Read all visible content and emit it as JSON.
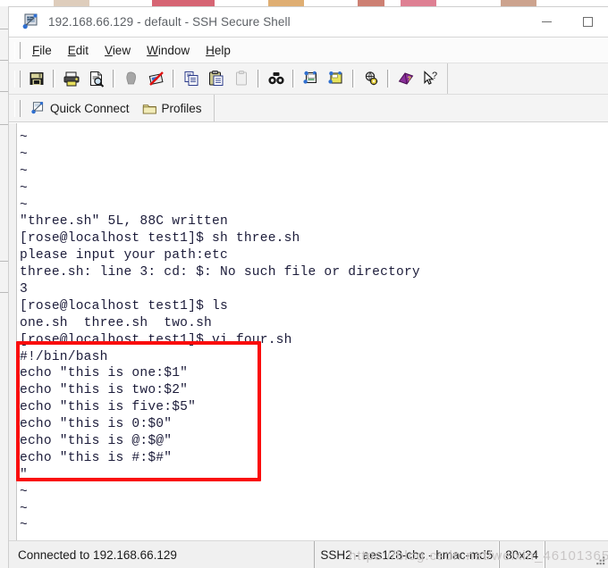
{
  "window": {
    "title": "192.168.66.129 - default - SSH Secure Shell",
    "app_icon": "ssh-terminal-icon",
    "controls": {
      "minimize": "—",
      "maximize": "□"
    }
  },
  "menubar": {
    "items": [
      {
        "label": "File",
        "accel": "F"
      },
      {
        "label": "Edit",
        "accel": "E"
      },
      {
        "label": "View",
        "accel": "V"
      },
      {
        "label": "Window",
        "accel": "W"
      },
      {
        "label": "Help",
        "accel": "H"
      }
    ]
  },
  "toolbar": {
    "buttons": [
      {
        "name": "save-icon",
        "title": "Save"
      },
      {
        "name": "print-icon",
        "title": "Print"
      },
      {
        "name": "print-preview-icon",
        "title": "Print Preview"
      },
      {
        "name": "connect-icon",
        "title": "Connect"
      },
      {
        "name": "disconnect-icon",
        "title": "Disconnect"
      },
      {
        "name": "copy-icon",
        "title": "Copy"
      },
      {
        "name": "paste-icon",
        "title": "Paste"
      },
      {
        "name": "paste-disabled-icon",
        "title": "Paste"
      },
      {
        "name": "find-icon",
        "title": "Find"
      },
      {
        "name": "new-file-transfer-icon",
        "title": "New File Transfer"
      },
      {
        "name": "new-terminal-icon",
        "title": "New Terminal"
      },
      {
        "name": "settings-icon",
        "title": "Settings"
      },
      {
        "name": "help-book-icon",
        "title": "Help"
      },
      {
        "name": "context-help-icon",
        "title": "Context Help"
      }
    ]
  },
  "quickbar": {
    "quick_connect": "Quick Connect",
    "quick_connect_icon": "quick-connect-icon",
    "profiles": "Profiles",
    "profiles_icon": "folder-icon"
  },
  "terminal": {
    "lines": [
      "~",
      "~",
      "~",
      "~",
      "~",
      "\"three.sh\" 5L, 88C written",
      "[rose@localhost test1]$ sh three.sh",
      "please input your path:etc",
      "three.sh: line 3: cd: $: No such file or directory",
      "3",
      "[rose@localhost test1]$ ls",
      "one.sh  three.sh  two.sh",
      "[rose@localhost test1]$ vi four.sh",
      "#!/bin/bash",
      "echo \"this is one:$1\"",
      "echo \"this is two:$2\"",
      "echo \"this is five:$5\"",
      "echo \"this is 0:$0\"",
      "echo \"this is @:$@\"",
      "echo \"this is #:$#\"",
      "\"",
      "~",
      "~",
      "~"
    ],
    "highlight": {
      "color": "#fa0c0c",
      "name": "red-annotation-box"
    }
  },
  "statusbar": {
    "connection": "Connected to 192.168.66.129",
    "cipher": "SSH2 - aes128-cbc - hmac-md5",
    "size": "80x24",
    "blank": "",
    "watermark": "https://blog.csdn.net/weixin_46101365",
    "resize_grip": "resize-grip-icon"
  }
}
